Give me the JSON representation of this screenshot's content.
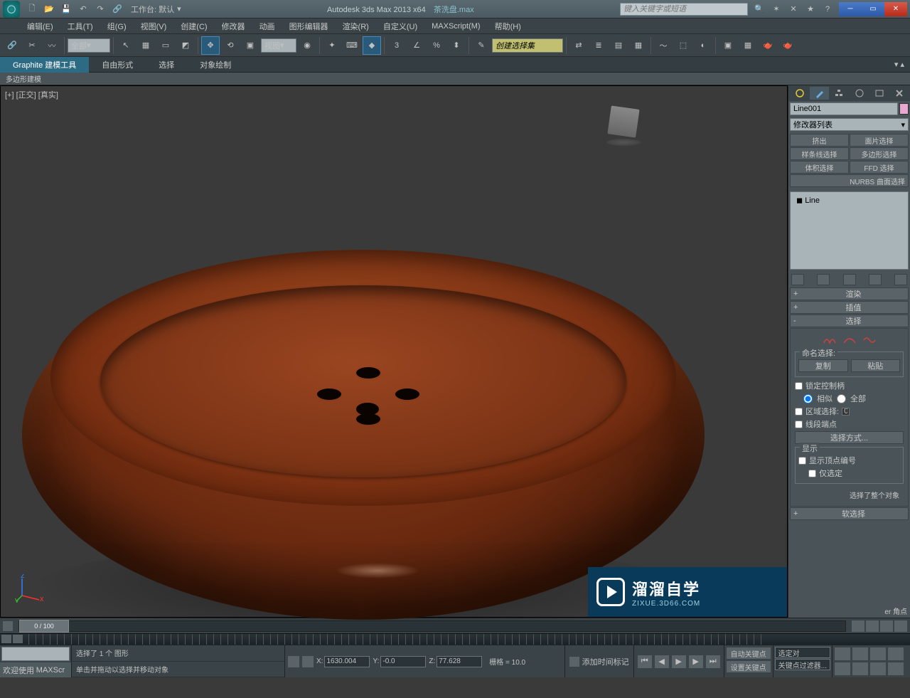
{
  "titlebar": {
    "workspace_label": "工作台: 默认",
    "app_title": "Autodesk 3ds Max  2013 x64",
    "file_name": "茶洗盘.max",
    "search_placeholder": "键入关键字或短语"
  },
  "menu": {
    "edit": "编辑(E)",
    "tools": "工具(T)",
    "group": "组(G)",
    "views": "视图(V)",
    "create": "创建(C)",
    "modifiers": "修改器",
    "animation": "动画",
    "graph": "图形编辑器",
    "rendering": "渲染(R)",
    "customize": "自定义(U)",
    "maxscript": "MAXScript(M)",
    "help": "帮助(H)"
  },
  "toolbar": {
    "filter_combo": "全部",
    "ref_coord": "视图",
    "named_sel_set": "创建选择集"
  },
  "ribbon": {
    "tab1": "Graphite 建模工具",
    "tab2": "自由形式",
    "tab3": "选择",
    "tab4": "对象绘制",
    "sub": "多边形建模"
  },
  "viewport": {
    "label": "[+] [正交] [真实]"
  },
  "cmd_panel": {
    "object_name": "Line001",
    "modifier_list": "修改器列表",
    "mod_buttons": {
      "extrude": "挤出",
      "face_select": "面片选择",
      "spline_select": "样条线选择",
      "poly_select": "多边形选择",
      "vol_select": "体积选择",
      "ffd_select": "FFD 选择",
      "nurbs_select": "NURBS 曲面选择"
    },
    "stack_item": "Line",
    "rollouts": {
      "render": "渲染",
      "interp": "插值",
      "selection": "选择",
      "soft_sel": "软选择"
    },
    "selection": {
      "named_sel": "命名选择:",
      "copy": "复制",
      "paste": "粘贴",
      "lock_handles": "锁定控制柄",
      "similar": "相似",
      "all": "全部",
      "area_select": "区域选择:",
      "area_val": "0.1",
      "seg_end": "线段端点",
      "select_by": "选择方式...",
      "display": "显示",
      "show_vert_num": "显示顶点编号",
      "sel_only": "仅选定",
      "status": "选择了整个对象"
    },
    "truncated": "er 角点"
  },
  "timeline": {
    "frame": "0 / 100"
  },
  "status": {
    "maxscript_label": "MAXScr",
    "welcome": "欢迎使用",
    "sel_msg": "选择了 1 个 图形",
    "prompt": "单击并拖动以选择并移动对象",
    "x": "1630.004",
    "y": "-0.0",
    "z": "77.628",
    "grid": "栅格 = 10.0",
    "add_time": "添加时间标记",
    "autokey": "自动关键点",
    "setkey": "设置关键点",
    "selected_combo": "选定对",
    "key_filter": "关键点过滤器..."
  },
  "watermark": {
    "title": "溜溜自学",
    "url": "ZIXUE.3D66.COM"
  }
}
